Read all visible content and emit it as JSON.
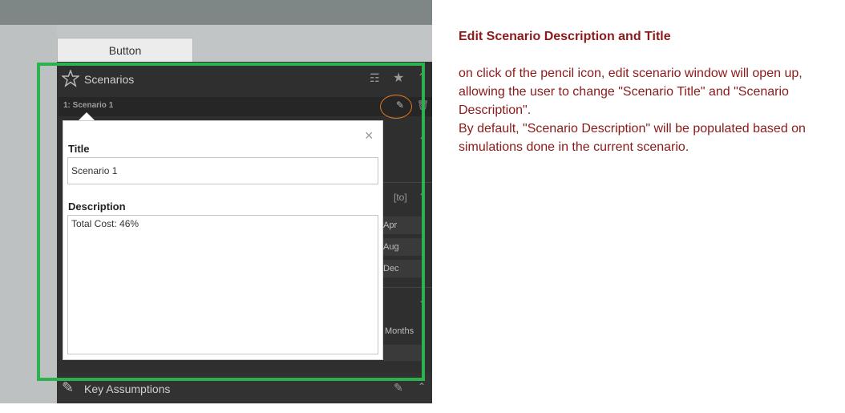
{
  "toolbar": {
    "button_label": "Button"
  },
  "scenarios_panel": {
    "title": "Scenarios",
    "current_scenario": "1: Scenario 1"
  },
  "background_panel": {
    "range_label": "[to]",
    "months": [
      "Apr",
      "Aug",
      "Dec"
    ],
    "months_label": "Months",
    "key_assumptions": "Key Assumptions"
  },
  "popup": {
    "close_symbol": "×",
    "title_label": "Title",
    "title_value": "Scenario 1",
    "description_label": "Description",
    "description_value": "Total Cost: 46%"
  },
  "notes": {
    "heading": "Edit Scenario Description and Title",
    "paragraph1": "on click of the pencil icon, edit scenario window will open up, allowing the user to change \"Scenario Title\" and \"Scenario Description\".",
    "paragraph2": "By default, \"Scenario Description\" will be populated based on simulations done in the current scenario."
  },
  "colors": {
    "highlight_frame": "#2bb24c",
    "pencil_circle": "#e07820",
    "notes_text": "#8b1a1a"
  }
}
